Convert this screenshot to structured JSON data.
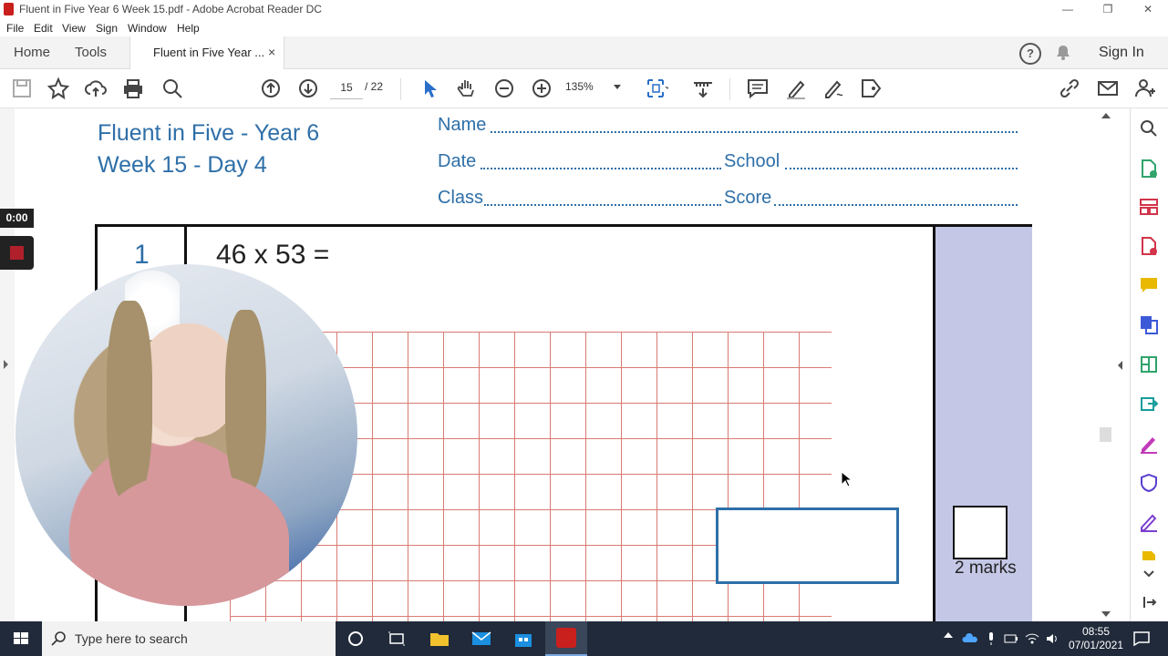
{
  "window": {
    "title": "Fluent in Five Year 6 Week 15.pdf - Adobe Acrobat Reader DC",
    "minimize": "—",
    "restore": "❐",
    "close": "✕"
  },
  "menu": [
    "File",
    "Edit",
    "View",
    "Sign",
    "Window",
    "Help"
  ],
  "tabs": {
    "home": "Home",
    "tools": "Tools",
    "document": "Fluent in Five Year ...",
    "close": "×",
    "sign_in": "Sign In"
  },
  "toolbar": {
    "page_current": "15",
    "page_total": "/ 22",
    "zoom": "135%"
  },
  "worksheet": {
    "title_line1": "Fluent in Five - Year 6",
    "title_line2": "Week 15 - Day 4",
    "name_label": "Name",
    "date_label": "Date",
    "school_label": "School",
    "class_label": "Class",
    "score_label": "Score",
    "question_number": "1",
    "question_text": "46 x 53 =",
    "marks": "2 marks"
  },
  "recorder": {
    "timer": "0:00"
  },
  "taskbar": {
    "search_placeholder": "Type here to search",
    "time": "08:55",
    "date": "07/01/2021"
  },
  "colors": {
    "accent": "#2e6fa8",
    "grid": "#d97a72",
    "marks_column": "#c4c8e6",
    "acrobat_red": "#c9201e"
  }
}
